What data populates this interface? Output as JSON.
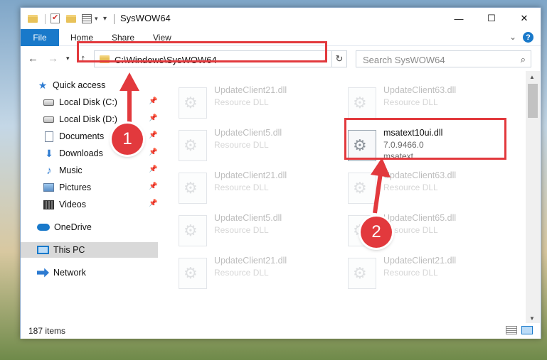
{
  "window": {
    "title": "SysWOW64",
    "controls": {
      "minimize": "—",
      "maximize": "☐",
      "close": "✕"
    }
  },
  "ribbon": {
    "tabs": [
      {
        "label": "File",
        "active": true
      },
      {
        "label": "Home"
      },
      {
        "label": "Share"
      },
      {
        "label": "View"
      }
    ],
    "help": "?"
  },
  "nav": {
    "address": "C:\\Windows\\SysWOW64",
    "search_placeholder": "Search SysWOW64"
  },
  "sidebar": {
    "items": [
      {
        "label": "Quick access",
        "icon": "star-icon"
      },
      {
        "label": "Local Disk (C:)",
        "icon": "disk-icon",
        "pinned": true
      },
      {
        "label": "Local Disk (D:)",
        "icon": "disk-icon",
        "pinned": true
      },
      {
        "label": "Documents",
        "icon": "document-icon",
        "pinned": true
      },
      {
        "label": "Downloads",
        "icon": "download-icon",
        "pinned": true
      },
      {
        "label": "Music",
        "icon": "music-icon",
        "pinned": true
      },
      {
        "label": "Pictures",
        "icon": "picture-icon",
        "pinned": true
      },
      {
        "label": "Videos",
        "icon": "video-icon",
        "pinned": true
      },
      {
        "label": "OneDrive",
        "icon": "cloud-icon"
      },
      {
        "label": "This PC",
        "icon": "computer-icon",
        "selected": true
      },
      {
        "label": "Network",
        "icon": "network-icon"
      }
    ]
  },
  "files": [
    {
      "name": "UpdateClient21.dll",
      "type": "Resource DLL",
      "ghost": true
    },
    {
      "name": "UpdateClient63.dll",
      "type": "Resource DLL",
      "ghost": true
    },
    {
      "name": "UpdateClient5.dll",
      "type": "Resource DLL",
      "ghost": true
    },
    {
      "name": "msatext10ui.dll",
      "version": "7.0.9466.0",
      "company": "msatext",
      "highlighted": true
    },
    {
      "name": "UpdateClient21.dll",
      "type": "Resource DLL",
      "ghost": true
    },
    {
      "name": "UpdateClient63.dll",
      "type": "Resource DLL",
      "ghost": true
    },
    {
      "name": "UpdateClient5.dll",
      "type": "Resource DLL",
      "ghost": true
    },
    {
      "name": "UpdateClient65.dll",
      "type": "Resource DLL",
      "ghost": true
    },
    {
      "name": "UpdateClient21.dll",
      "type": "Resource DLL",
      "ghost": true
    },
    {
      "name": "UpdateClient21.dll",
      "type": "Resource DLL",
      "ghost": true
    }
  ],
  "status": {
    "count": "187 items"
  },
  "annotations": {
    "step1": "1",
    "step2": "2",
    "color": "#e2393d"
  }
}
